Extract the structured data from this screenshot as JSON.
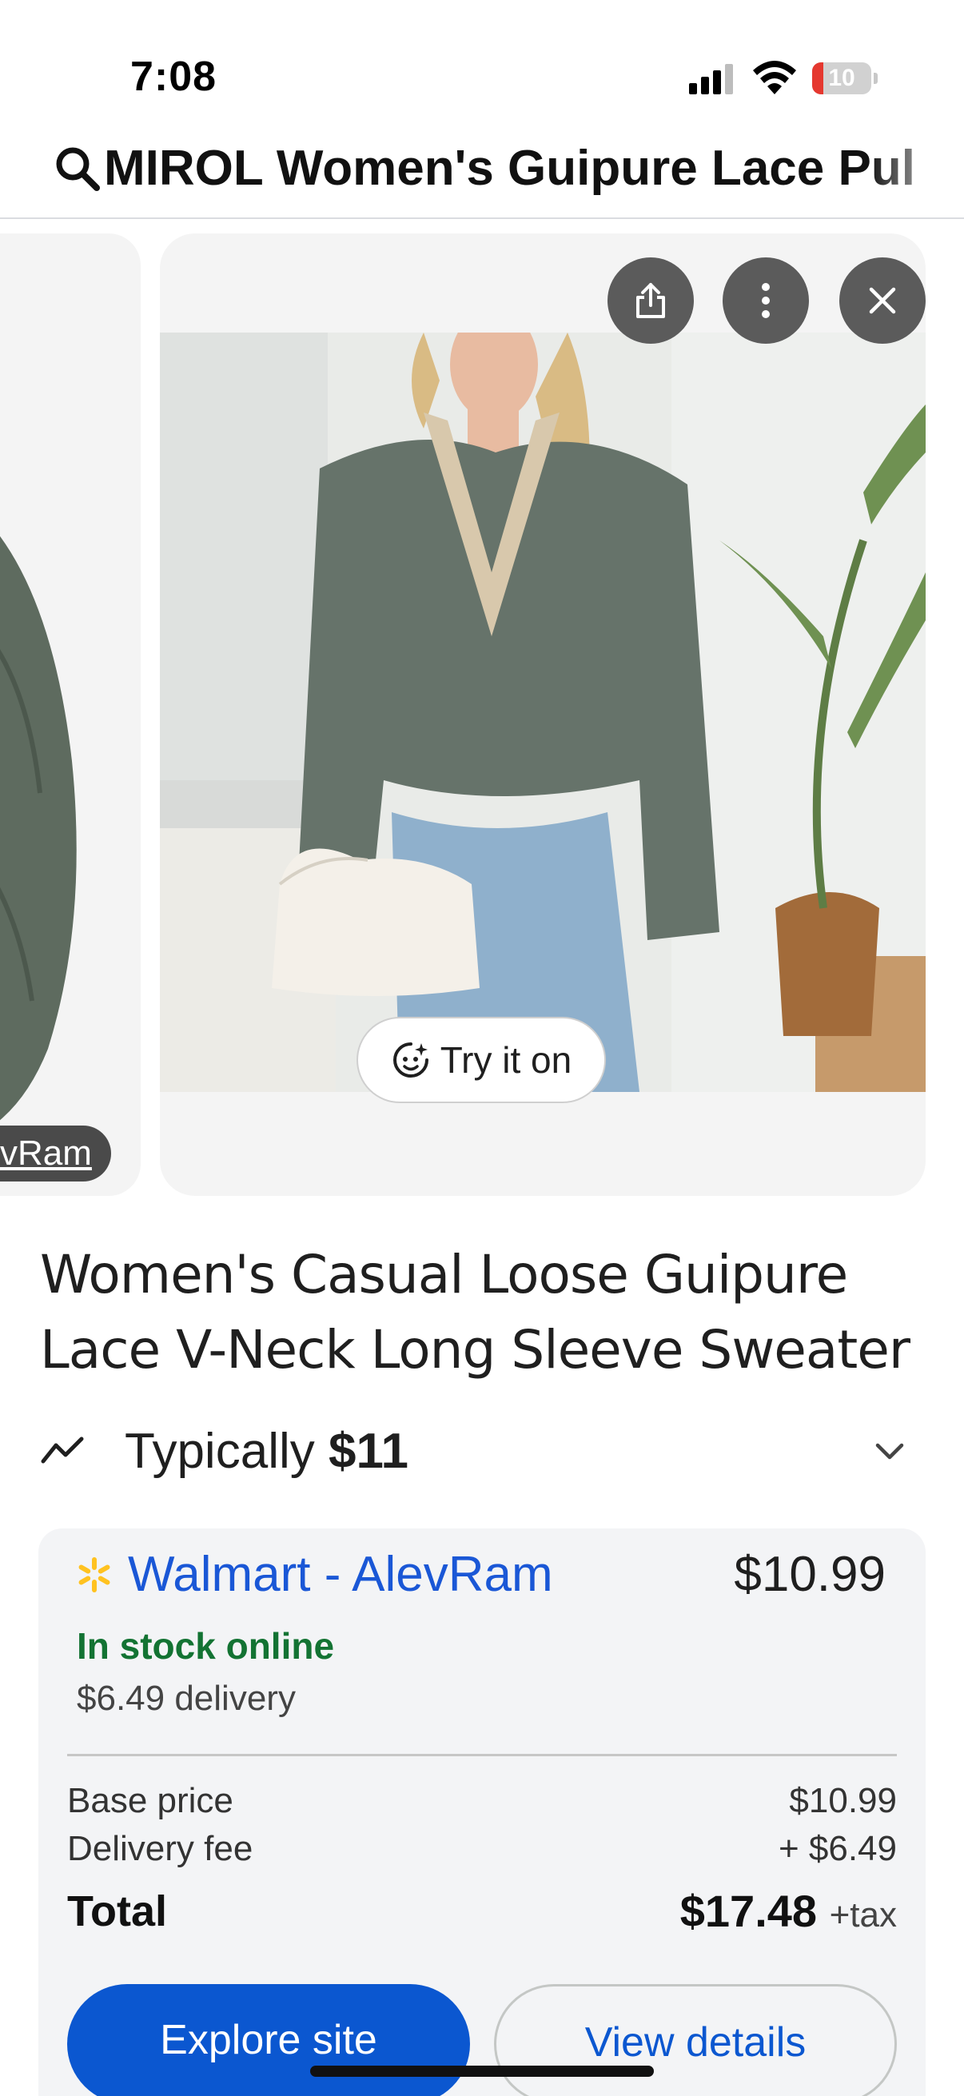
{
  "status_bar": {
    "time": "7:08",
    "battery_level": "10",
    "battery_color": "#e5382f"
  },
  "search": {
    "query": "MIROL Women's Guipure Lace Pul"
  },
  "carousel": {
    "previous_card_merchant": "vRam",
    "try_on_label": "Try it on",
    "icons": [
      "share-icon",
      "more-vert-icon",
      "close-icon",
      "try-on-icon"
    ]
  },
  "product": {
    "title": "Women's Casual Loose Guipure Lace V-Neck Long Sleeve Sweater",
    "typically_label": "Typically",
    "typically_price": "$11"
  },
  "offer": {
    "seller": "Walmart - AlevRam",
    "price": "$10.99",
    "stock_status": "In stock online",
    "delivery": "$6.49 delivery",
    "base_price_label": "Base price",
    "base_price_value": "$10.99",
    "delivery_fee_label": "Delivery fee",
    "delivery_fee_value": "+ $6.49",
    "total_label": "Total",
    "total_value": "$17.48",
    "total_suffix": "+tax",
    "explore_button": "Explore site",
    "details_button": "View details"
  },
  "colors": {
    "link_blue": "#1a57d6",
    "primary_button": "#0b57d0",
    "in_stock_green": "#137333",
    "walmart_yellow": "#ffc220"
  }
}
